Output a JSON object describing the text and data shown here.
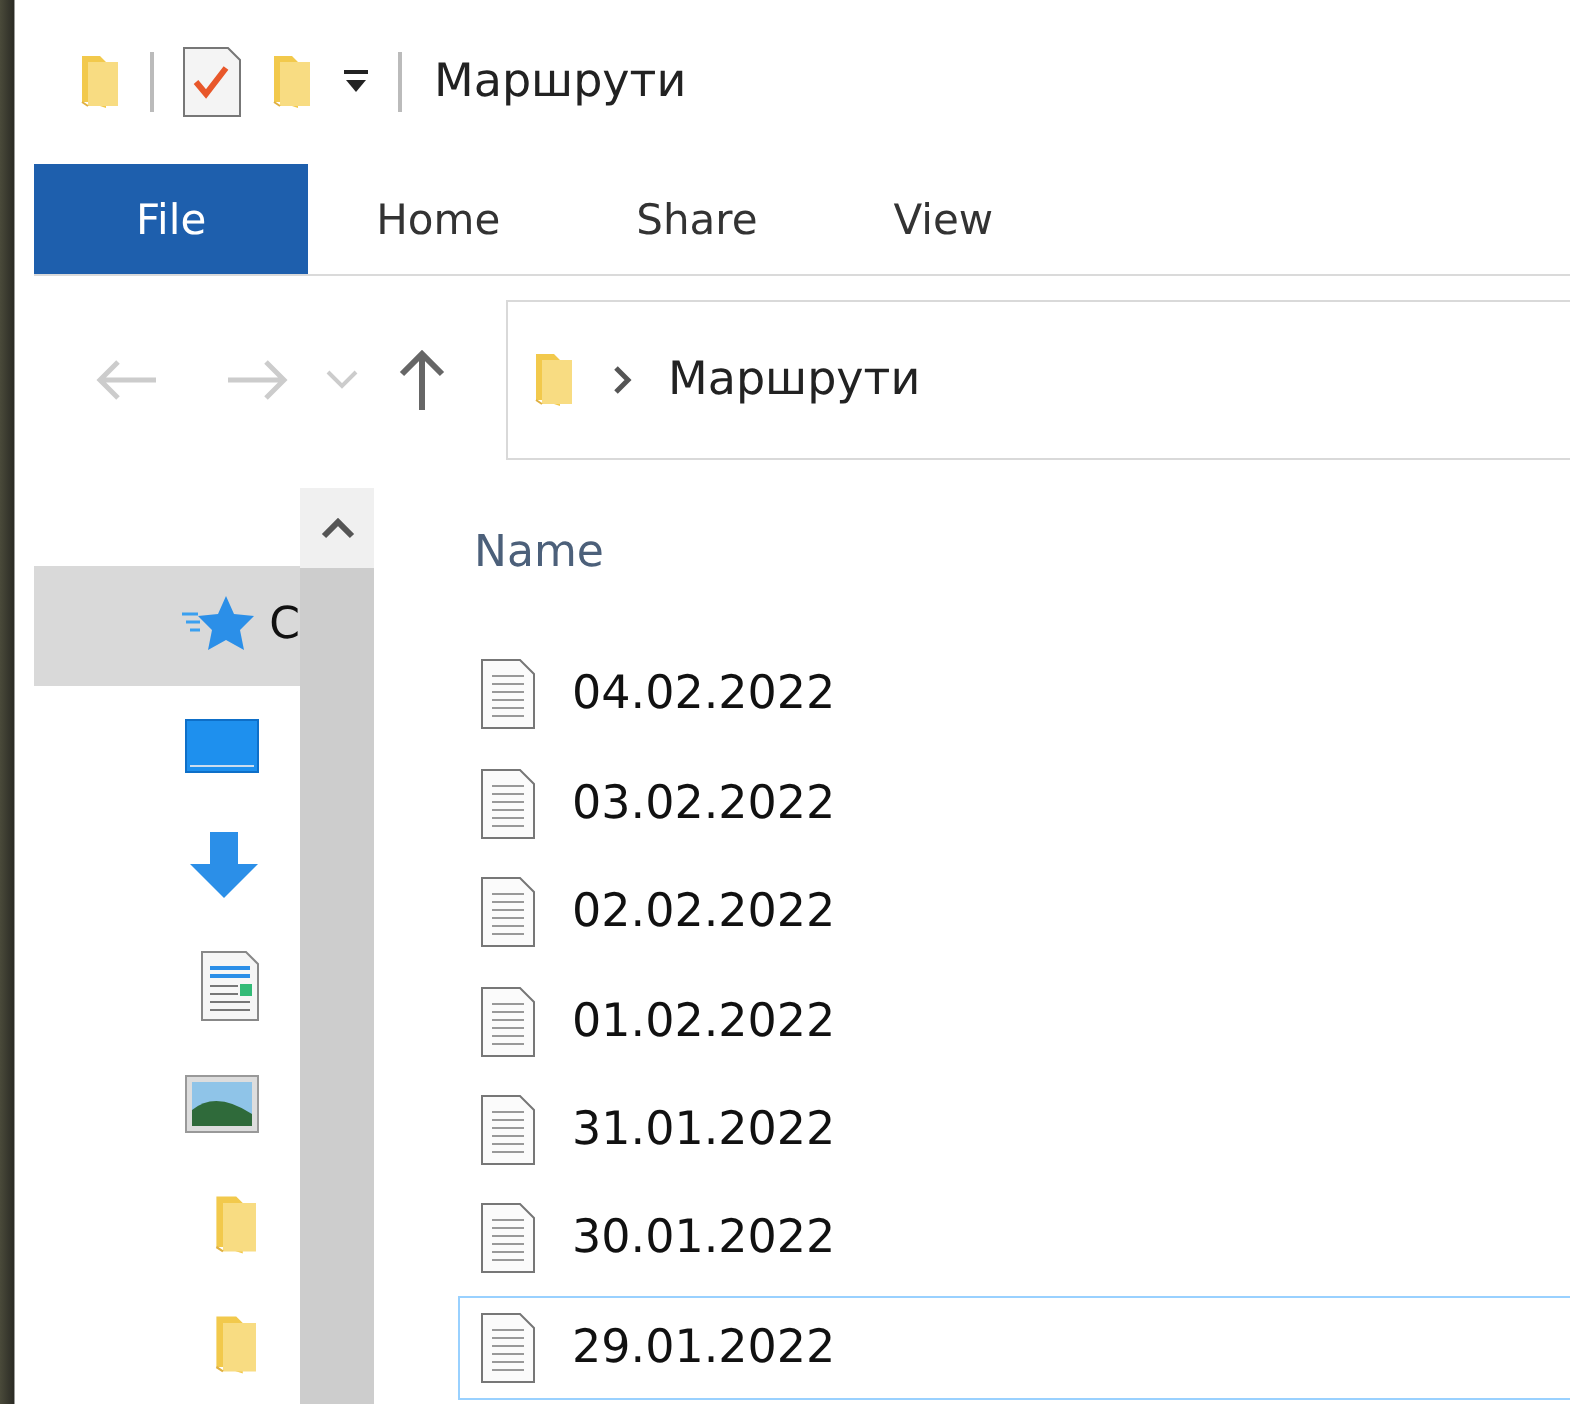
{
  "window": {
    "title": "Маршрути"
  },
  "ribbon_tabs": [
    {
      "label": "File",
      "selected": true
    },
    {
      "label": "Home",
      "selected": false
    },
    {
      "label": "Share",
      "selected": false
    },
    {
      "label": "View",
      "selected": false
    }
  ],
  "address_bar": {
    "path": "Маршрути"
  },
  "nav_pane": {
    "items": [
      {
        "kind": "quick-access",
        "label": "C",
        "selected": true
      },
      {
        "kind": "desktop",
        "selected": false
      },
      {
        "kind": "downloads",
        "selected": false
      },
      {
        "kind": "documents",
        "selected": false
      },
      {
        "kind": "pictures",
        "selected": false
      },
      {
        "kind": "folder",
        "selected": false
      },
      {
        "kind": "folder",
        "selected": false
      }
    ]
  },
  "file_list": {
    "columns": [
      "Name"
    ],
    "rows": [
      {
        "name": "04.02.2022",
        "focused": false
      },
      {
        "name": "03.02.2022",
        "focused": false
      },
      {
        "name": "02.02.2022",
        "focused": false
      },
      {
        "name": "01.02.2022",
        "focused": false
      },
      {
        "name": "31.01.2022",
        "focused": false
      },
      {
        "name": "30.01.2022",
        "focused": false
      },
      {
        "name": "29.01.2022",
        "focused": true
      }
    ]
  }
}
